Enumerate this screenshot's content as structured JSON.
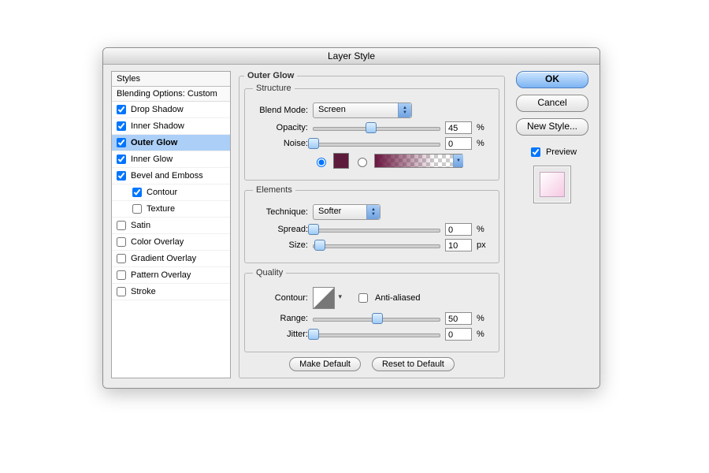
{
  "window": {
    "title": "Layer Style"
  },
  "sidebar": {
    "header": "Styles",
    "blending": "Blending Options: Custom",
    "items": [
      {
        "label": "Drop Shadow",
        "checked": true
      },
      {
        "label": "Inner Shadow",
        "checked": true
      },
      {
        "label": "Outer Glow",
        "checked": true,
        "selected": true
      },
      {
        "label": "Inner Glow",
        "checked": true
      },
      {
        "label": "Bevel and Emboss",
        "checked": true
      },
      {
        "label": "Contour",
        "checked": true,
        "indent": true
      },
      {
        "label": "Texture",
        "checked": false,
        "indent": true
      },
      {
        "label": "Satin",
        "checked": false
      },
      {
        "label": "Color Overlay",
        "checked": false
      },
      {
        "label": "Gradient Overlay",
        "checked": false
      },
      {
        "label": "Pattern Overlay",
        "checked": false
      },
      {
        "label": "Stroke",
        "checked": false
      }
    ]
  },
  "panel": {
    "title": "Outer Glow",
    "structure": {
      "legend": "Structure",
      "blend_mode_label": "Blend Mode:",
      "blend_mode_value": "Screen",
      "opacity_label": "Opacity:",
      "opacity_value": "45",
      "opacity_unit": "%",
      "noise_label": "Noise:",
      "noise_value": "0",
      "noise_unit": "%",
      "color_hex": "#5c1b3a"
    },
    "elements": {
      "legend": "Elements",
      "technique_label": "Technique:",
      "technique_value": "Softer",
      "spread_label": "Spread:",
      "spread_value": "0",
      "spread_unit": "%",
      "size_label": "Size:",
      "size_value": "10",
      "size_unit": "px"
    },
    "quality": {
      "legend": "Quality",
      "contour_label": "Contour:",
      "antialias_label": "Anti-aliased",
      "range_label": "Range:",
      "range_value": "50",
      "range_unit": "%",
      "jitter_label": "Jitter:",
      "jitter_value": "0",
      "jitter_unit": "%"
    },
    "make_default": "Make Default",
    "reset_default": "Reset to Default"
  },
  "buttons": {
    "ok": "OK",
    "cancel": "Cancel",
    "new_style": "New Style...",
    "preview": "Preview"
  }
}
